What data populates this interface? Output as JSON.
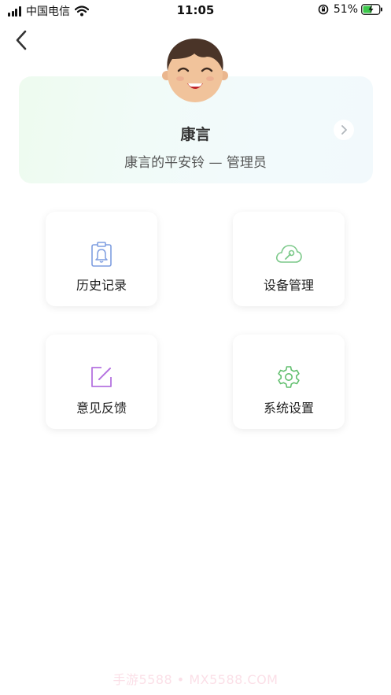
{
  "status_bar": {
    "carrier": "中国电信",
    "time": "11:05",
    "battery_percent": "51%"
  },
  "profile": {
    "name": "康言",
    "subtitle": "康言的平安铃 — 管理员"
  },
  "menu": {
    "tiles": [
      {
        "label": "历史记录",
        "icon": "clipboard-bell-icon",
        "color": "#7f9ee0"
      },
      {
        "label": "设备管理",
        "icon": "cloud-wrench-icon",
        "color": "#7cc98a"
      },
      {
        "label": "意见反馈",
        "icon": "edit-square-icon",
        "color": "#b573e0"
      },
      {
        "label": "系统设置",
        "icon": "gear-icon",
        "color": "#62bf6f"
      }
    ]
  },
  "watermark": "手游5588 • MX5588.COM"
}
